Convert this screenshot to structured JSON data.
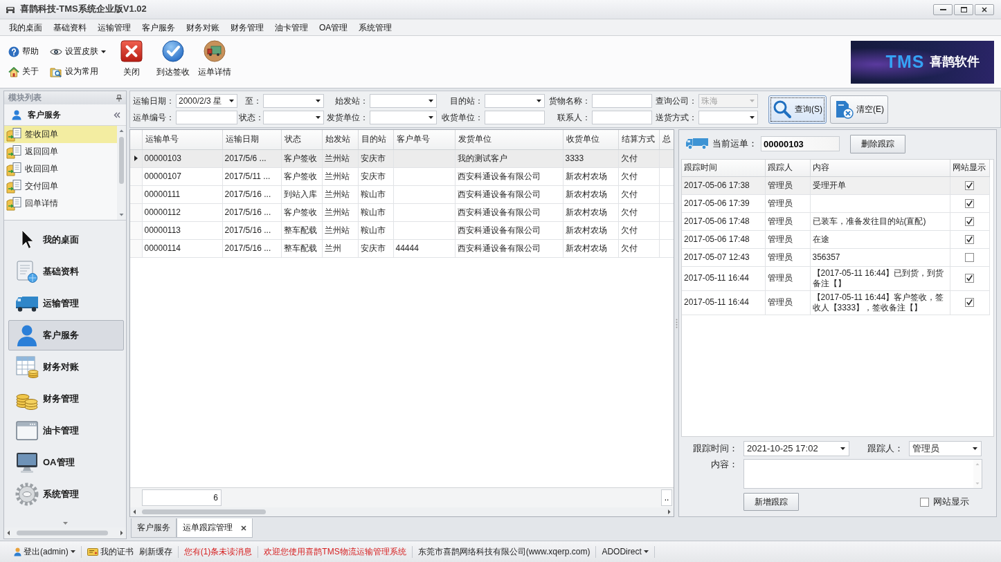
{
  "window": {
    "title": "喜鹊科技-TMS系统企业版V1.02"
  },
  "menu": [
    "我的桌面",
    "基础资料",
    "运输管理",
    "客户服务",
    "财务对账",
    "财务管理",
    "油卡管理",
    "OA管理",
    "系统管理"
  ],
  "toolbar": {
    "small_buttons": [
      {
        "label": "帮助",
        "kind": "help",
        "dropdown": false
      },
      {
        "label": "设置皮肤",
        "kind": "skin",
        "dropdown": true
      },
      {
        "label": "关于",
        "kind": "about",
        "dropdown": false
      },
      {
        "label": "设为常用",
        "kind": "favorite",
        "dropdown": false
      }
    ],
    "large_buttons": [
      {
        "label": "关闭",
        "kind": "close"
      },
      {
        "label": "到达签收",
        "kind": "sign"
      },
      {
        "label": "运单详情",
        "kind": "detail"
      }
    ]
  },
  "logo": {
    "brand": "TMS",
    "name": "喜鹊软件"
  },
  "sidebar": {
    "title": "模块列表",
    "group": "客户服务",
    "items": [
      {
        "label": "签收回单",
        "selected": true
      },
      {
        "label": "返回回单",
        "selected": false
      },
      {
        "label": "收回回单",
        "selected": false
      },
      {
        "label": "交付回单",
        "selected": false
      },
      {
        "label": "回单详情",
        "selected": false
      }
    ],
    "modules": [
      {
        "label": "我的桌面",
        "kind": "desktop",
        "selected": false
      },
      {
        "label": "基础资料",
        "kind": "basic",
        "selected": false
      },
      {
        "label": "运输管理",
        "kind": "transport",
        "selected": false
      },
      {
        "label": "客户服务",
        "kind": "customer",
        "selected": true
      },
      {
        "label": "财务对账",
        "kind": "reconcile",
        "selected": false
      },
      {
        "label": "财务管理",
        "kind": "finance",
        "selected": false
      },
      {
        "label": "油卡管理",
        "kind": "fuel",
        "selected": false
      },
      {
        "label": "OA管理",
        "kind": "oa",
        "selected": false
      },
      {
        "label": "系统管理",
        "kind": "system",
        "selected": false
      }
    ]
  },
  "filters": [
    {
      "label": "运输日期：",
      "kind": "dropdown",
      "value": "2000/2/3 星",
      "disabled": false
    },
    {
      "label": "至：",
      "kind": "dropdown",
      "disabled": false
    },
    {
      "label": "始发站：",
      "kind": "dropdown",
      "disabled": false
    },
    {
      "label": "目的站：",
      "kind": "dropdown",
      "disabled": false
    },
    {
      "label": "货物名称：",
      "kind": "text",
      "disabled": false
    },
    {
      "label": "查询公司：",
      "kind": "dropdown",
      "value": "珠海",
      "disabled": true
    },
    {
      "label": "运单编号：",
      "kind": "text",
      "disabled": false
    },
    {
      "label": "状态：",
      "kind": "dropdown",
      "disabled": false
    },
    {
      "label": "发货单位：",
      "kind": "dropdown",
      "disabled": false
    },
    {
      "label": "收货单位：",
      "kind": "text",
      "disabled": false
    },
    {
      "label": "联系人：",
      "kind": "text",
      "disabled": false
    },
    {
      "label": "送货方式：",
      "kind": "dropdown",
      "disabled": false
    }
  ],
  "query_buttons": [
    {
      "label": "查询(S)",
      "kind": "search",
      "focused": true
    },
    {
      "label": "清空(E)",
      "kind": "clear",
      "focused": false
    }
  ],
  "waybills": {
    "columns": [
      "运输单号",
      "运输日期",
      "状态",
      "始发站",
      "目的站",
      "客户单号",
      "发货单位",
      "收货单位",
      "结算方式",
      "总"
    ],
    "rows": [
      {
        "selected": true,
        "waybill_no": "00000103",
        "ship_date": "2017/5/6 ...",
        "status": "客户签收",
        "origin": "兰州站",
        "destination": "安庆市",
        "shipper": "我的测试客户",
        "consignee": "3333",
        "settlement": "欠付"
      },
      {
        "selected": false,
        "waybill_no": "00000107",
        "ship_date": "2017/5/11 ...",
        "status": "客户签收",
        "origin": "兰州站",
        "destination": "安庆市",
        "shipper": "西安科通设备有限公司",
        "consignee": "新农村农场",
        "settlement": "欠付"
      },
      {
        "selected": false,
        "waybill_no": "00000111",
        "ship_date": "2017/5/16 ...",
        "status": "到站入库",
        "origin": "兰州站",
        "destination": "鞍山市",
        "shipper": "西安科通设备有限公司",
        "consignee": "新农村农场",
        "settlement": "欠付"
      },
      {
        "selected": false,
        "waybill_no": "00000112",
        "ship_date": "2017/5/16 ...",
        "status": "客户签收",
        "origin": "兰州站",
        "destination": "鞍山市",
        "shipper": "西安科通设备有限公司",
        "consignee": "新农村农场",
        "settlement": "欠付"
      },
      {
        "selected": false,
        "waybill_no": "00000113",
        "ship_date": "2017/5/16 ...",
        "status": "整车配载",
        "origin": "兰州站",
        "destination": "鞍山市",
        "shipper": "西安科通设备有限公司",
        "consignee": "新农村农场",
        "settlement": "欠付"
      },
      {
        "selected": false,
        "waybill_no": "00000114",
        "ship_date": "2017/5/16 ...",
        "status": "整车配载",
        "origin": "兰州",
        "destination": "安庆市",
        "customer_no": "44444",
        "shipper": "西安科通设备有限公司",
        "consignee": "新农村农场",
        "settlement": "欠付"
      }
    ],
    "footer": {
      "count": "6",
      "more": ".."
    }
  },
  "tracking": {
    "current_label": "当前运单：",
    "current_value": "00000103",
    "delete_button": "删除跟踪",
    "columns": [
      "跟踪时间",
      "跟踪人",
      "内容",
      "网站显示"
    ],
    "rows": [
      {
        "time": "2017-05-06 17:38",
        "person": "管理员",
        "content": "受理开单",
        "web_visible": true,
        "selected": true
      },
      {
        "time": "2017-05-06 17:39",
        "person": "管理员",
        "web_visible": true,
        "selected": false
      },
      {
        "time": "2017-05-06 17:48",
        "person": "管理员",
        "content": "已装车，准备发往目的站(直配)",
        "web_visible": true,
        "selected": false
      },
      {
        "time": "2017-05-06 17:48",
        "person": "管理员",
        "content": "在途",
        "web_visible": true,
        "selected": false
      },
      {
        "time": "2017-05-07 12:43",
        "person": "管理员",
        "content": "356357",
        "web_visible": false,
        "selected": false
      },
      {
        "time": "2017-05-11 16:44",
        "person": "管理员",
        "content": "【2017-05-11 16:44】已到货，到货备注【】",
        "web_visible": true,
        "selected": false
      },
      {
        "time": "2017-05-11 16:44",
        "person": "管理员",
        "content": "【2017-05-11 16:44】客户签收，签收人【3333】，签收备注【】",
        "web_visible": true,
        "selected": false
      }
    ],
    "form": {
      "time_label": "跟踪时间：",
      "time_value": "2021-10-25 17:02",
      "person_label": "跟踪人：",
      "person_value": "管理员",
      "content_label": "内容：",
      "add_button": "新增跟踪",
      "web_visible_label": "网站显示",
      "web_visible": false
    }
  },
  "tabs": [
    {
      "label": "客户服务",
      "selected": false
    },
    {
      "label": "运单跟踪管理",
      "selected": true
    }
  ],
  "status_bar": [
    {
      "items": [
        {
          "label": "登出(admin)",
          "kind": "user",
          "dropdown": true
        }
      ]
    },
    {
      "items": [
        {
          "label": "我的证书",
          "kind": "certificate",
          "dropdown": false
        },
        {
          "label": "刷新缓存",
          "kind": "action",
          "dropdown": false
        }
      ]
    },
    {
      "items": [
        {
          "label": "您有(1)条未读消息",
          "kind": "alert",
          "dropdown": false
        }
      ]
    },
    {
      "items": [
        {
          "label": "欢迎您使用喜鹊TMS物流运输管理系统",
          "kind": "alert",
          "dropdown": false
        }
      ]
    },
    {
      "items": [
        {
          "label": "东莞市喜鹊网络科技有限公司(www.xqerp.com)",
          "kind": "plain",
          "dropdown": false
        }
      ]
    },
    {
      "items": [
        {
          "label": "ADODirect",
          "kind": "plain",
          "dropdown": true
        }
      ]
    }
  ]
}
